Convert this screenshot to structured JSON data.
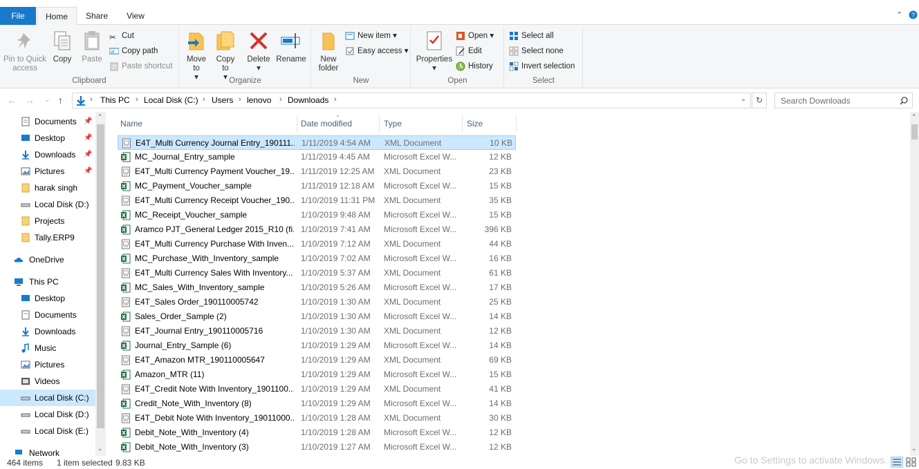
{
  "window": {
    "title": "Downloads"
  },
  "tabs": {
    "file": "File",
    "home": "Home",
    "share": "Share",
    "view": "View"
  },
  "ribbon": {
    "clipboard": {
      "label": "Clipboard",
      "pin": "Pin to Quick access",
      "copy": "Copy",
      "paste": "Paste",
      "cut": "Cut",
      "copy_path": "Copy path",
      "paste_shortcut": "Paste shortcut"
    },
    "organize": {
      "label": "Organize",
      "move_to": "Move to",
      "copy_to": "Copy to",
      "delete": "Delete",
      "rename": "Rename"
    },
    "new": {
      "label": "New",
      "new_folder": "New folder",
      "new_item": "New item",
      "easy_access": "Easy access"
    },
    "open": {
      "label": "Open",
      "properties": "Properties",
      "open": "Open",
      "edit": "Edit",
      "history": "History"
    },
    "select": {
      "label": "Select",
      "select_all": "Select all",
      "select_none": "Select none",
      "invert": "Invert selection"
    }
  },
  "address": {
    "crumbs": [
      "This PC",
      "Local Disk (C:)",
      "Users",
      "lenovo",
      "Downloads"
    ],
    "search_placeholder": "Search Downloads"
  },
  "nav": {
    "quick": [
      "Documents",
      "Desktop",
      "Downloads",
      "Pictures",
      "harak singh",
      "Local Disk (D:)",
      "Projects",
      "Tally.ERP9"
    ],
    "onedrive": "OneDrive",
    "thispc": "This PC",
    "pc_items": [
      "Desktop",
      "Documents",
      "Downloads",
      "Music",
      "Pictures",
      "Videos",
      "Local Disk (C:)",
      "Local Disk (D:)",
      "Local Disk (E:)"
    ],
    "network": "Network"
  },
  "columns": {
    "name": "Name",
    "date": "Date modified",
    "type": "Type",
    "size": "Size"
  },
  "files": [
    {
      "name": "E4T_Multi Currency Journal Entry_190111...",
      "date": "1/11/2019 4:54 AM",
      "type": "XML Document",
      "size": "10 KB",
      "kind": "xml"
    },
    {
      "name": "MC_Journal_Entry_sample",
      "date": "1/11/2019 4:45 AM",
      "type": "Microsoft Excel W...",
      "size": "12 KB",
      "kind": "xls"
    },
    {
      "name": "E4T_Multi Currency Payment Voucher_19...",
      "date": "1/11/2019 12:25 AM",
      "type": "XML Document",
      "size": "23 KB",
      "kind": "xml"
    },
    {
      "name": "MC_Payment_Voucher_sample",
      "date": "1/11/2019 12:18 AM",
      "type": "Microsoft Excel W...",
      "size": "15 KB",
      "kind": "xls"
    },
    {
      "name": "E4T_Multi Currency Receipt Voucher_190...",
      "date": "1/10/2019 11:31 PM",
      "type": "XML Document",
      "size": "35 KB",
      "kind": "xml"
    },
    {
      "name": "MC_Receipt_Voucher_sample",
      "date": "1/10/2019 9:48 AM",
      "type": "Microsoft Excel W...",
      "size": "15 KB",
      "kind": "xls"
    },
    {
      "name": "Aramco PJT_General Ledger 2015_R10 (fi...",
      "date": "1/10/2019 7:41 AM",
      "type": "Microsoft Excel W...",
      "size": "396 KB",
      "kind": "xls"
    },
    {
      "name": "E4T_Multi Currency Purchase With Inven...",
      "date": "1/10/2019 7:12 AM",
      "type": "XML Document",
      "size": "44 KB",
      "kind": "xml"
    },
    {
      "name": "MC_Purchase_With_Inventory_sample",
      "date": "1/10/2019 7:02 AM",
      "type": "Microsoft Excel W...",
      "size": "16 KB",
      "kind": "xls"
    },
    {
      "name": "E4T_Multi Currency Sales With Inventory...",
      "date": "1/10/2019 5:37 AM",
      "type": "XML Document",
      "size": "61 KB",
      "kind": "xml"
    },
    {
      "name": "MC_Sales_With_Inventory_sample",
      "date": "1/10/2019 5:26 AM",
      "type": "Microsoft Excel W...",
      "size": "17 KB",
      "kind": "xls"
    },
    {
      "name": "E4T_Sales Order_190110005742",
      "date": "1/10/2019 1:30 AM",
      "type": "XML Document",
      "size": "25 KB",
      "kind": "xml"
    },
    {
      "name": "Sales_Order_Sample (2)",
      "date": "1/10/2019 1:30 AM",
      "type": "Microsoft Excel W...",
      "size": "14 KB",
      "kind": "xls"
    },
    {
      "name": "E4T_Journal Entry_190110005716",
      "date": "1/10/2019 1:30 AM",
      "type": "XML Document",
      "size": "12 KB",
      "kind": "xml"
    },
    {
      "name": "Journal_Entry_Sample (6)",
      "date": "1/10/2019 1:29 AM",
      "type": "Microsoft Excel W...",
      "size": "14 KB",
      "kind": "xls"
    },
    {
      "name": "E4T_Amazon MTR_190110005647",
      "date": "1/10/2019 1:29 AM",
      "type": "XML Document",
      "size": "69 KB",
      "kind": "xml"
    },
    {
      "name": "Amazon_MTR (11)",
      "date": "1/10/2019 1:29 AM",
      "type": "Microsoft Excel W...",
      "size": "15 KB",
      "kind": "xls"
    },
    {
      "name": "E4T_Credit Note With Inventory_1901100...",
      "date": "1/10/2019 1:29 AM",
      "type": "XML Document",
      "size": "41 KB",
      "kind": "xml"
    },
    {
      "name": "Credit_Note_With_Inventory (8)",
      "date": "1/10/2019 1:29 AM",
      "type": "Microsoft Excel W...",
      "size": "14 KB",
      "kind": "xls"
    },
    {
      "name": "E4T_Debit Note With Inventory_19011000...",
      "date": "1/10/2019 1:28 AM",
      "type": "XML Document",
      "size": "30 KB",
      "kind": "xml"
    },
    {
      "name": "Debit_Note_With_Inventory (4)",
      "date": "1/10/2019 1:28 AM",
      "type": "Microsoft Excel W...",
      "size": "12 KB",
      "kind": "xls"
    },
    {
      "name": "Debit_Note_With_Inventory (3)",
      "date": "1/10/2019 1:27 AM",
      "type": "Microsoft Excel W...",
      "size": "12 KB",
      "kind": "xls"
    }
  ],
  "status": {
    "count": "464 items",
    "selected": "1 item selected",
    "sel_size": "9.83 KB"
  },
  "watermark": "Go to Settings to activate Windows."
}
